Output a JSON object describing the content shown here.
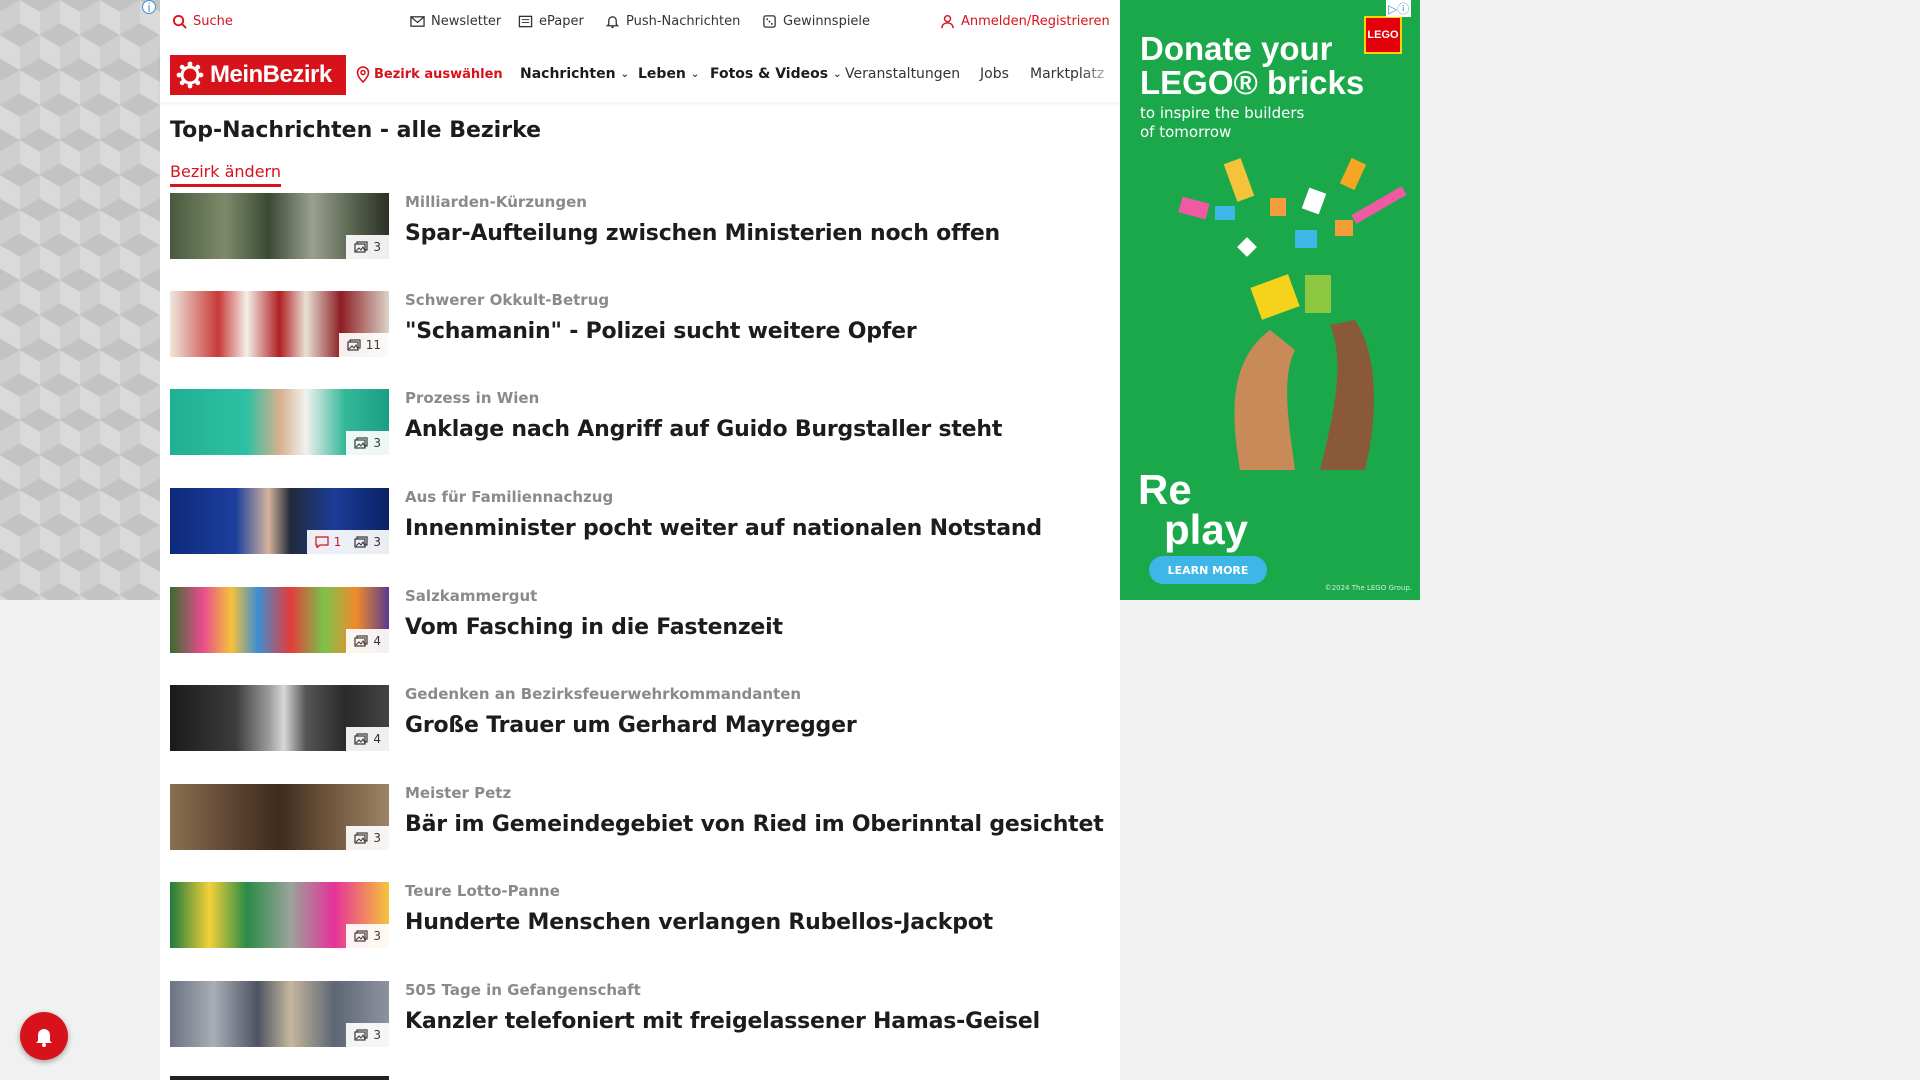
{
  "topbar": {
    "search_label": "Suche",
    "newsletter_label": "Newsletter",
    "epaper_label": "ePaper",
    "push_label": "Push-Nachrichten",
    "gewinnspiele_label": "Gewinnspiele",
    "login_label": "Anmelden/Registrieren"
  },
  "nav": {
    "logo_text": "MeinBezirk",
    "district_label": "Bezirk auswählen",
    "items": [
      {
        "label": "Nachrichten"
      },
      {
        "label": "Leben"
      },
      {
        "label": "Fotos & Videos"
      },
      {
        "label": "Veranstaltungen"
      },
      {
        "label": "Jobs"
      },
      {
        "label": "Marktplatz"
      }
    ]
  },
  "main": {
    "title": "Top-Nachrichten - alle Bezirke",
    "change_district": "Bezirk ändern",
    "articles": [
      {
        "kicker": "Milliarden-Kürzungen",
        "headline": "Spar-Aufteilung zwischen Ministerien noch offen",
        "photos": "3",
        "comments": ""
      },
      {
        "kicker": "Schwerer Okkult-Betrug",
        "headline": "\"Schamanin\" - Polizei sucht weitere Opfer",
        "photos": "11",
        "comments": ""
      },
      {
        "kicker": "Prozess in Wien",
        "headline": "Anklage nach Angriff auf Guido Burgstaller steht",
        "photos": "3",
        "comments": ""
      },
      {
        "kicker": "Aus für Familiennachzug",
        "headline": "Innenminister pocht weiter auf nationalen Notstand",
        "photos": "3",
        "comments": "1"
      },
      {
        "kicker": "Salzkammergut",
        "headline": "Vom Fasching in die Fastenzeit",
        "photos": "4",
        "comments": ""
      },
      {
        "kicker": "Gedenken an Bezirksfeuerwehrkommandanten",
        "headline": "Große Trauer um Gerhard Mayregger",
        "photos": "4",
        "comments": ""
      },
      {
        "kicker": "Meister Petz",
        "headline": "Bär im Gemeindegebiet von Ried im Oberinntal gesichtet",
        "photos": "3",
        "comments": ""
      },
      {
        "kicker": "Teure Lotto-Panne",
        "headline": "Hunderte Menschen verlangen Rubellos-Jackpot",
        "photos": "3",
        "comments": ""
      },
      {
        "kicker": "505 Tage in Gefangenschaft",
        "headline": "Kanzler telefoniert mit freigelassener Hamas-Geisel",
        "photos": "3",
        "comments": ""
      }
    ]
  },
  "ad": {
    "headline_line1": "Donate your",
    "headline_line2": "LEGO® bricks",
    "subline_1": "to inspire the builders",
    "subline_2": "of tomorrow",
    "brand": "LEGO",
    "replay_1": "Re",
    "replay_2": "play",
    "button": "LEARN MORE",
    "copyright": "©2024 The LEGO Group."
  },
  "colors": {
    "brand_red": "#d8121b",
    "ad_green": "#1aa84a"
  }
}
